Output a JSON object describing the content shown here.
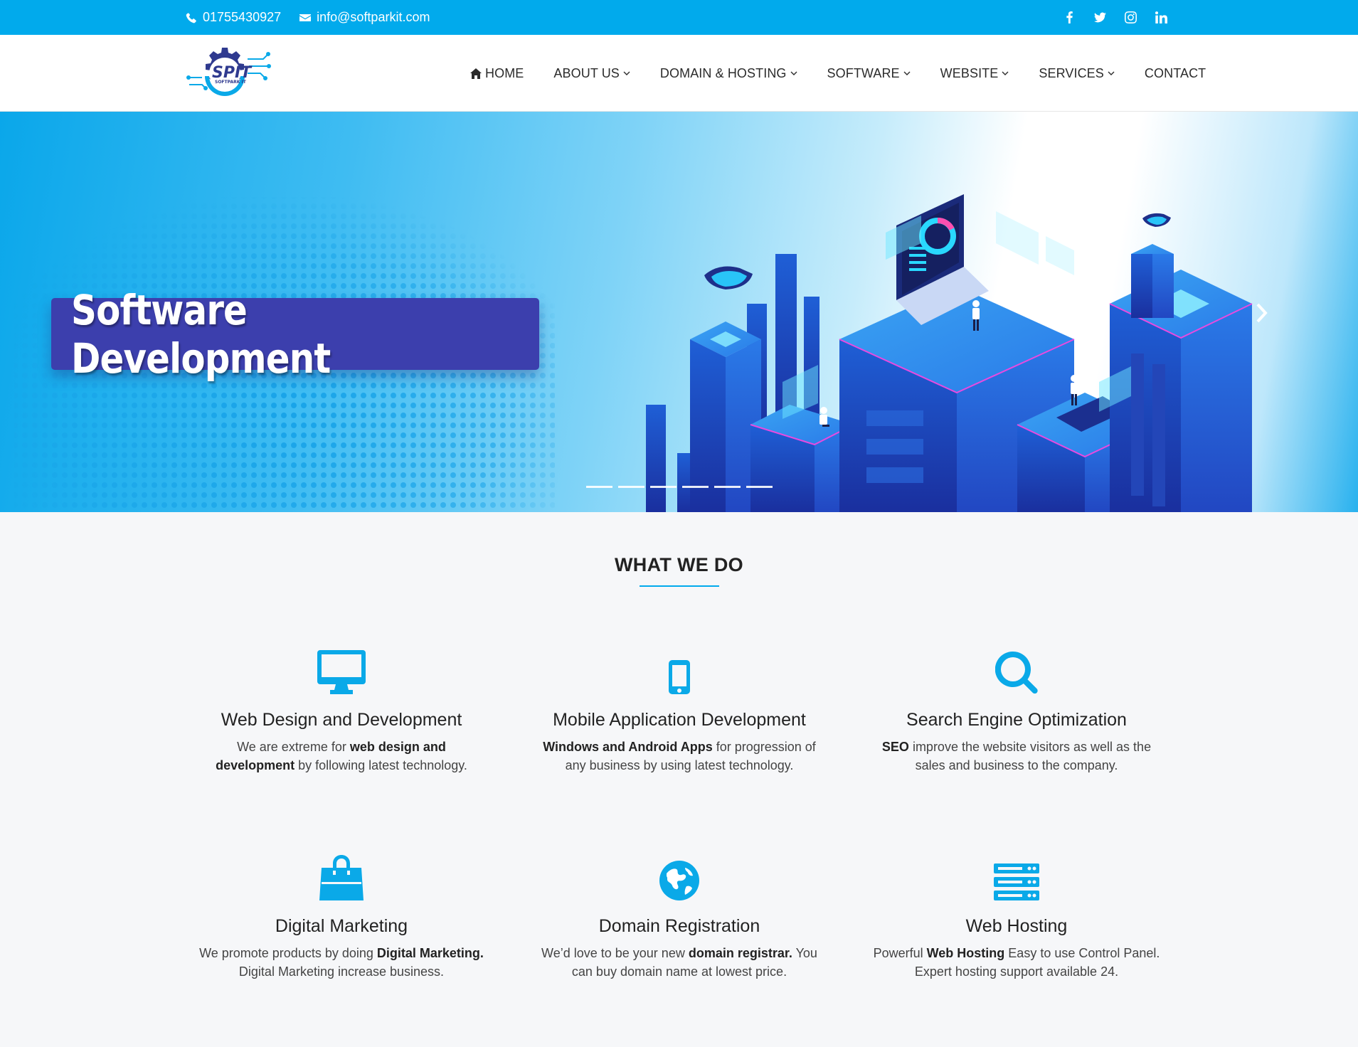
{
  "topbar": {
    "phone": "01755430927",
    "email": "info@softparkit.com",
    "socials": [
      "facebook-icon",
      "twitter-icon",
      "instagram-icon",
      "linkedin-icon"
    ]
  },
  "logo": {
    "main": "SPIT",
    "sub": "SOFTPARK IT"
  },
  "nav": {
    "items": [
      {
        "label": "HOME",
        "icon": "home-icon"
      },
      {
        "label": "ABOUT US"
      },
      {
        "label": "DOMAIN & HOSTING"
      },
      {
        "label": "SOFTWARE"
      },
      {
        "label": "WEBSITE"
      },
      {
        "label": "SERVICES"
      },
      {
        "label": "CONTACT"
      }
    ]
  },
  "hero": {
    "slide_title": "Software Development",
    "indicator_count": 6
  },
  "what_we_do": {
    "title": "WHAT WE DO",
    "services": [
      {
        "icon": "desktop-icon",
        "title": "Web Design and Development",
        "desc_1": "We are extreme for ",
        "desc_bold": "web design and development",
        "desc_2": " by following latest technology."
      },
      {
        "icon": "mobile-icon",
        "title": "Mobile Application Development",
        "desc_1": "",
        "desc_bold": "Windows and Android Apps",
        "desc_2": " for progression of any business by using latest technology."
      },
      {
        "icon": "search-icon",
        "title": "Search Engine Optimization",
        "desc_1": "",
        "desc_bold": "SEO",
        "desc_2": " improve the website visitors as well as the sales and business to the company."
      },
      {
        "icon": "shopping-bag-icon",
        "title": "Digital Marketing",
        "desc_1": "We promote products by doing ",
        "desc_bold": "Digital Marketing.",
        "desc_2": " Digital Marketing increase business."
      },
      {
        "icon": "globe-icon",
        "title": "Domain Registration",
        "desc_1": "We’d love to be your new ",
        "desc_bold": "domain registrar.",
        "desc_2": " You can buy domain name at lowest price."
      },
      {
        "icon": "server-icon",
        "title": "Web Hosting",
        "desc_1": "Powerful ",
        "desc_bold": "Web Hosting",
        "desc_2": " Easy to use Control Panel. Expert hosting support available 24."
      }
    ]
  },
  "colors": {
    "accent": "#01aaec",
    "slide_box": "#3c3fad",
    "icon": "#0aa9e8"
  }
}
